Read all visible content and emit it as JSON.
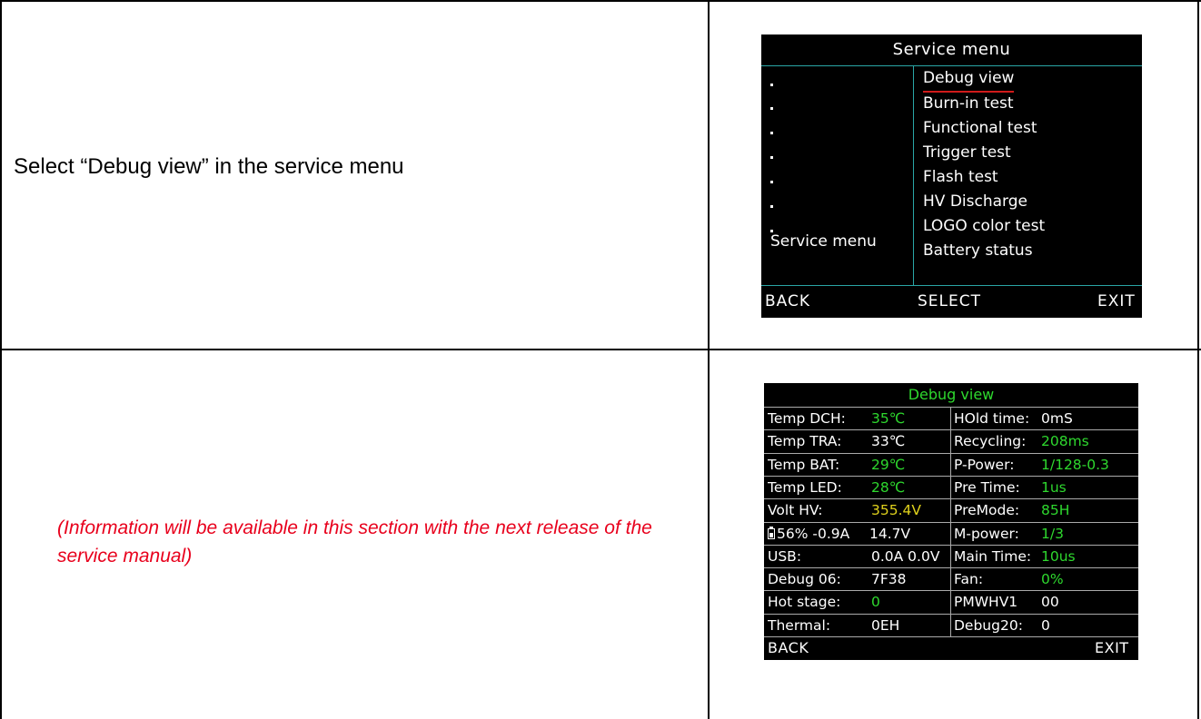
{
  "instruction_text": "Select “Debug view” in the service menu",
  "note_text": "(Information will be available in this section with the next release of the service manual)",
  "service_menu": {
    "title": "Service menu",
    "left_label": "Service menu",
    "items": [
      "Debug view",
      "Burn-in test",
      "Functional test",
      "Trigger test",
      "Flash test",
      "HV Discharge",
      "LOGO color test",
      "Battery status"
    ],
    "selected_index": 0,
    "softkeys": {
      "left": "BACK",
      "center": "SELECT",
      "right": "EXIT"
    },
    "colors": {
      "divider": "#2aa6a6",
      "selected_underline": "#d01a1a"
    }
  },
  "debug_view": {
    "title": "Debug view",
    "rows": [
      {
        "l_label": "Temp DCH:",
        "l_value": "35℃",
        "l_color": "green",
        "r_label": "HOld time:",
        "r_value": "0mS",
        "r_color": "white"
      },
      {
        "l_label": "Temp TRA:",
        "l_value": "33℃",
        "l_color": "white",
        "r_label": "Recycling:",
        "r_value": "208ms",
        "r_color": "green"
      },
      {
        "l_label": "Temp BAT:",
        "l_value": "29℃",
        "l_color": "green",
        "r_label": "P-Power:",
        "r_value": "1/128-0.3",
        "r_color": "green"
      },
      {
        "l_label": "Temp LED:",
        "l_value": "28℃",
        "l_color": "green",
        "r_label": "Pre Time:",
        "r_value": "1us",
        "r_color": "green"
      },
      {
        "l_label": "Volt HV:",
        "l_value": "355.4V",
        "l_color": "yellow",
        "r_label": "PreMode:",
        "r_value": "85H",
        "r_color": "green"
      },
      {
        "l_label": "56% -0.9A",
        "l_value": "14.7V",
        "l_color": "white",
        "r_label": "M-power:",
        "r_value": "1/3",
        "r_color": "green",
        "battery": true
      },
      {
        "l_label": "USB:",
        "l_value": "0.0A  0.0V",
        "l_color": "white",
        "r_label": "Main Time:",
        "r_value": "10us",
        "r_color": "green"
      },
      {
        "l_label": "Debug 06:",
        "l_value": "7F38",
        "l_color": "white",
        "r_label": "Fan:",
        "r_value": "0%",
        "r_color": "green"
      },
      {
        "l_label": "Hot stage:",
        "l_value": "0",
        "l_color": "green",
        "r_label": "PMWHV1",
        "r_value": "00",
        "r_color": "white"
      },
      {
        "l_label": "Thermal:",
        "l_value": "0EH",
        "l_color": "white",
        "r_label": "Debug20:",
        "r_value": "0",
        "r_color": "white"
      }
    ],
    "softkeys": {
      "left": "BACK",
      "right": "EXIT"
    },
    "colors": {
      "green": "#2ed82e",
      "yellow": "#e0d21c",
      "white": "#ffffff",
      "grid": "#aaaaaa"
    }
  }
}
